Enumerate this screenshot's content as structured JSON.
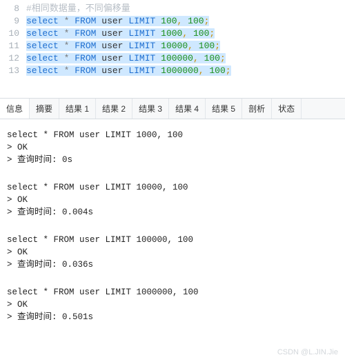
{
  "editor": {
    "lines": [
      {
        "num": 8,
        "selected": false,
        "tokens": [
          {
            "cls": "tok-comment",
            "text": "#相同数据量，不同偏移量"
          }
        ]
      },
      {
        "num": 9,
        "selected": true,
        "tokens": [
          {
            "cls": "tok-kw",
            "text": "select"
          },
          {
            "cls": "",
            "text": " "
          },
          {
            "cls": "tok-star",
            "text": "*"
          },
          {
            "cls": "",
            "text": " "
          },
          {
            "cls": "tok-kw",
            "text": "FROM"
          },
          {
            "cls": "",
            "text": " "
          },
          {
            "cls": "tok-ident",
            "text": "user"
          },
          {
            "cls": "",
            "text": " "
          },
          {
            "cls": "tok-kw",
            "text": "LIMIT"
          },
          {
            "cls": "",
            "text": " "
          },
          {
            "cls": "tok-num",
            "text": "100"
          },
          {
            "cls": "tok-punc",
            "text": ","
          },
          {
            "cls": "",
            "text": " "
          },
          {
            "cls": "tok-num",
            "text": "100"
          },
          {
            "cls": "tok-punc",
            "text": ";"
          }
        ]
      },
      {
        "num": 10,
        "selected": true,
        "tokens": [
          {
            "cls": "tok-kw",
            "text": "select"
          },
          {
            "cls": "",
            "text": " "
          },
          {
            "cls": "tok-star",
            "text": "*"
          },
          {
            "cls": "",
            "text": " "
          },
          {
            "cls": "tok-kw",
            "text": "FROM"
          },
          {
            "cls": "",
            "text": " "
          },
          {
            "cls": "tok-ident",
            "text": "user"
          },
          {
            "cls": "",
            "text": " "
          },
          {
            "cls": "tok-kw",
            "text": "LIMIT"
          },
          {
            "cls": "",
            "text": " "
          },
          {
            "cls": "tok-num",
            "text": "1000"
          },
          {
            "cls": "tok-punc",
            "text": ","
          },
          {
            "cls": "",
            "text": " "
          },
          {
            "cls": "tok-num",
            "text": "100"
          },
          {
            "cls": "tok-punc",
            "text": ";"
          }
        ]
      },
      {
        "num": 11,
        "selected": true,
        "tokens": [
          {
            "cls": "tok-kw",
            "text": "select"
          },
          {
            "cls": "",
            "text": " "
          },
          {
            "cls": "tok-star",
            "text": "*"
          },
          {
            "cls": "",
            "text": " "
          },
          {
            "cls": "tok-kw",
            "text": "FROM"
          },
          {
            "cls": "",
            "text": " "
          },
          {
            "cls": "tok-ident",
            "text": "user"
          },
          {
            "cls": "",
            "text": " "
          },
          {
            "cls": "tok-kw",
            "text": "LIMIT"
          },
          {
            "cls": "",
            "text": " "
          },
          {
            "cls": "tok-num",
            "text": "10000"
          },
          {
            "cls": "tok-punc",
            "text": ","
          },
          {
            "cls": "",
            "text": " "
          },
          {
            "cls": "tok-num",
            "text": "100"
          },
          {
            "cls": "tok-punc",
            "text": ";"
          }
        ]
      },
      {
        "num": 12,
        "selected": true,
        "tokens": [
          {
            "cls": "tok-kw",
            "text": "select"
          },
          {
            "cls": "",
            "text": " "
          },
          {
            "cls": "tok-star",
            "text": "*"
          },
          {
            "cls": "",
            "text": " "
          },
          {
            "cls": "tok-kw",
            "text": "FROM"
          },
          {
            "cls": "",
            "text": " "
          },
          {
            "cls": "tok-ident",
            "text": "user"
          },
          {
            "cls": "",
            "text": " "
          },
          {
            "cls": "tok-kw",
            "text": "LIMIT"
          },
          {
            "cls": "",
            "text": " "
          },
          {
            "cls": "tok-num",
            "text": "100000"
          },
          {
            "cls": "tok-punc",
            "text": ","
          },
          {
            "cls": "",
            "text": " "
          },
          {
            "cls": "tok-num",
            "text": "100"
          },
          {
            "cls": "tok-punc",
            "text": ";"
          }
        ]
      },
      {
        "num": 13,
        "selected": true,
        "tokens": [
          {
            "cls": "tok-kw",
            "text": "select"
          },
          {
            "cls": "",
            "text": " "
          },
          {
            "cls": "tok-star",
            "text": "*"
          },
          {
            "cls": "",
            "text": " "
          },
          {
            "cls": "tok-kw",
            "text": "FROM"
          },
          {
            "cls": "",
            "text": " "
          },
          {
            "cls": "tok-ident",
            "text": "user"
          },
          {
            "cls": "",
            "text": " "
          },
          {
            "cls": "tok-kw",
            "text": "LIMIT"
          },
          {
            "cls": "",
            "text": " "
          },
          {
            "cls": "tok-num",
            "text": "1000000"
          },
          {
            "cls": "tok-punc",
            "text": ","
          },
          {
            "cls": "",
            "text": " "
          },
          {
            "cls": "tok-num",
            "text": "100"
          },
          {
            "cls": "tok-punc",
            "text": ";"
          }
        ]
      }
    ]
  },
  "tabs": {
    "items": [
      {
        "label": "信息",
        "active": true
      },
      {
        "label": "摘要",
        "active": false
      },
      {
        "label": "结果 1",
        "active": false
      },
      {
        "label": "结果 2",
        "active": false
      },
      {
        "label": "结果 3",
        "active": false
      },
      {
        "label": "结果 4",
        "active": false
      },
      {
        "label": "结果 5",
        "active": false
      },
      {
        "label": "剖析",
        "active": false
      },
      {
        "label": "状态",
        "active": false
      }
    ]
  },
  "output": {
    "groups": [
      {
        "query": "select * FROM user LIMIT 1000, 100",
        "status": "> OK",
        "time": "> 查询时间: 0s"
      },
      {
        "query": "select * FROM user LIMIT 10000, 100",
        "status": "> OK",
        "time": "> 查询时间: 0.004s"
      },
      {
        "query": "select * FROM user LIMIT 100000, 100",
        "status": "> OK",
        "time": "> 查询时间: 0.036s"
      },
      {
        "query": "select * FROM user LIMIT 1000000, 100",
        "status": "> OK",
        "time": "> 查询时间: 0.501s"
      }
    ]
  },
  "watermark": "CSDN @L.JIN.Jie"
}
